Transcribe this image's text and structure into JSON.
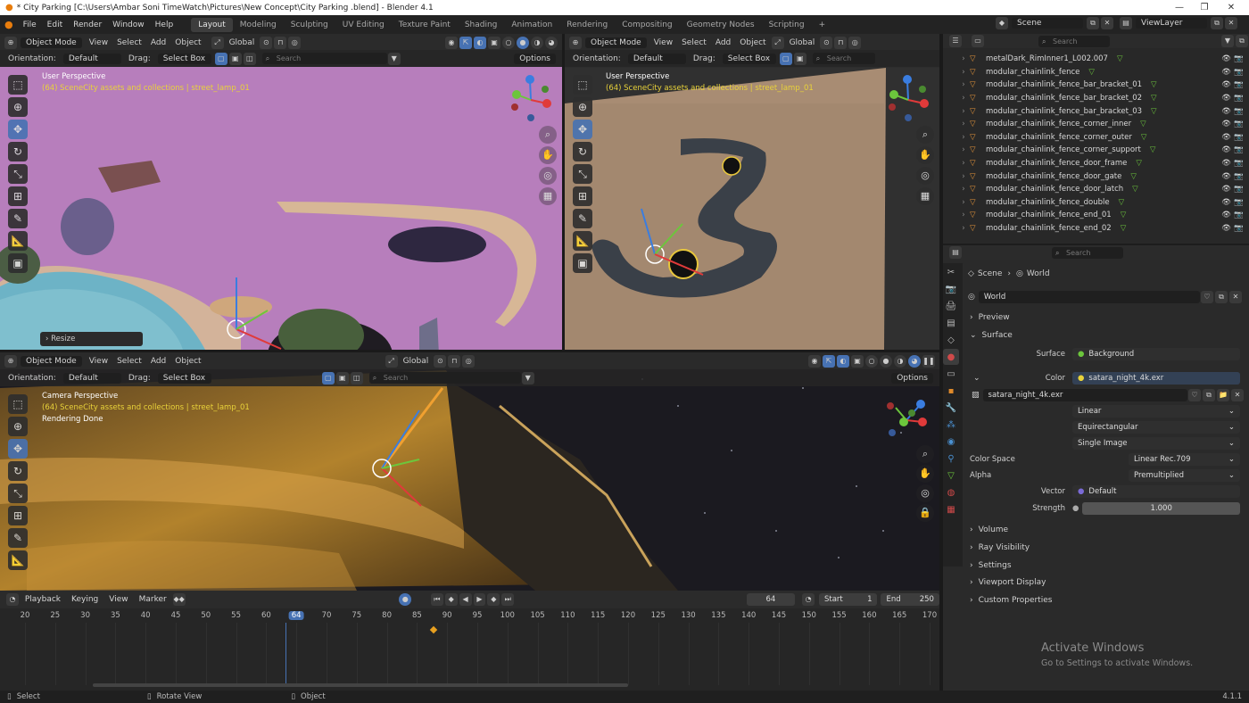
{
  "window": {
    "title": "* City Parking  [C:\\Users\\Ambar Soni TimeWatch\\Pictures\\New Concept\\City Parking .blend] - Blender 4.1",
    "controls": [
      "—",
      "❐",
      "✕"
    ]
  },
  "menu": [
    "File",
    "Edit",
    "Render",
    "Window",
    "Help"
  ],
  "workspaces": [
    "Layout",
    "Modeling",
    "Sculpting",
    "UV Editing",
    "Texture Paint",
    "Shading",
    "Animation",
    "Rendering",
    "Compositing",
    "Geometry Nodes",
    "Scripting",
    "+"
  ],
  "scene_selector": {
    "scene": "Scene",
    "view_layer": "ViewLayer"
  },
  "viewport_header": {
    "mode": "Object Mode",
    "menus": [
      "View",
      "Select",
      "Add",
      "Object"
    ],
    "transform_orientation": "Global",
    "orientation_label": "Orientation:",
    "orientation_value": "Default",
    "drag_label": "Drag:",
    "drag_value": "Select Box",
    "search_placeholder": "Search",
    "options": "Options"
  },
  "viewports": {
    "top_left": {
      "view_name": "User Perspective",
      "collection": "(64) SceneCity assets and collections | street_lamp_01",
      "operator_panel": "Resize"
    },
    "top_right": {
      "view_name": "User Perspective",
      "collection": "(64) SceneCity assets and collections | street_lamp_01"
    },
    "bottom": {
      "view_name": "Camera Perspective",
      "collection": "(64) SceneCity assets and collections | street_lamp_01",
      "status": "Rendering Done"
    }
  },
  "outliner": {
    "search_placeholder": "Search",
    "items": [
      "metalDark_RimInner1_L002.007",
      "modular_chainlink_fence",
      "modular_chainlink_fence_bar_bracket_01",
      "modular_chainlink_fence_bar_bracket_02",
      "modular_chainlink_fence_bar_bracket_03",
      "modular_chainlink_fence_corner_inner",
      "modular_chainlink_fence_corner_outer",
      "modular_chainlink_fence_corner_support",
      "modular_chainlink_fence_door_frame",
      "modular_chainlink_fence_door_gate",
      "modular_chainlink_fence_door_latch",
      "modular_chainlink_fence_double",
      "modular_chainlink_fence_end_01",
      "modular_chainlink_fence_end_02"
    ]
  },
  "properties": {
    "search_placeholder": "Search",
    "breadcrumb": [
      "Scene",
      "World"
    ],
    "world_name": "World",
    "panels": {
      "preview": "Preview",
      "surface": "Surface",
      "volume": "Volume",
      "ray_visibility": "Ray Visibility",
      "settings": "Settings",
      "viewport_display": "Viewport Display",
      "custom_properties": "Custom Properties"
    },
    "surface_label": "Surface",
    "surface_value": "Background",
    "color_label": "Color",
    "color_value": "satara_night_4k.exr",
    "image_name": "satara_night_4k.exr",
    "interpolation": "Linear",
    "projection": "Equirectangular",
    "source": "Single Image",
    "color_space_label": "Color Space",
    "color_space_value": "Linear Rec.709",
    "alpha_label": "Alpha",
    "alpha_value": "Premultiplied",
    "vector_label": "Vector",
    "vector_value": "Default",
    "strength_label": "Strength",
    "strength_value": "1.000"
  },
  "timeline": {
    "menus": [
      "Playback",
      "Keying",
      "View",
      "Marker"
    ],
    "current_frame": "64",
    "start_label": "Start",
    "start_value": "1",
    "end_label": "End",
    "end_value": "250",
    "ruler": [
      "20",
      "25",
      "30",
      "35",
      "40",
      "45",
      "50",
      "55",
      "60",
      "64",
      "70",
      "75",
      "80",
      "85",
      "90",
      "95",
      "100",
      "105",
      "110",
      "115",
      "120",
      "125",
      "130",
      "135",
      "140",
      "145",
      "150",
      "155",
      "160",
      "165",
      "170"
    ],
    "keyframe": "88"
  },
  "watermark": {
    "line1": "Activate Windows",
    "line2": "Go to Settings to activate Windows."
  },
  "statusbar": {
    "select": "Select",
    "rotate": "Rotate View",
    "object": "Object",
    "version": "4.1.1"
  },
  "colors": {
    "accent": "#4772b3",
    "active_frame": "#4772b3",
    "collection_text": "#e8d23a",
    "keyframe": "#e8a020"
  }
}
